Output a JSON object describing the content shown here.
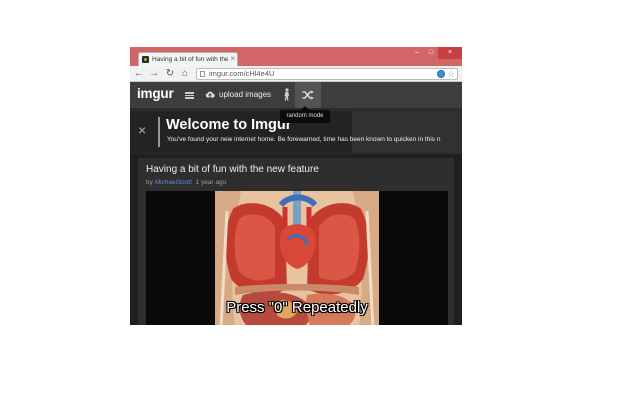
{
  "browser": {
    "tab_title": "Having a bit of fun with the",
    "tab_close": "×",
    "url": "imgur.com/cHl4e4U",
    "nav": {
      "back": "←",
      "forward": "→",
      "reload": "↻",
      "home": "⌂"
    },
    "window_controls": {
      "minimize": "–",
      "maximize": "□",
      "close": "×"
    },
    "star": "☆"
  },
  "imgur": {
    "logo": "imgur",
    "upload_label": "upload images",
    "tooltip": "random mode",
    "welcome": {
      "close": "×",
      "title": "Welcome to Imgur",
      "subtitle": "You've found your new internet home. Be forewarned, time has been known to quicken in this n"
    },
    "post": {
      "title": "Having a bit of fun with the new feature",
      "by": "by",
      "author": "MichaelScott",
      "age": "1 year ago",
      "caption": "Press \"0\" Repeatedly"
    }
  },
  "colors": {
    "window_frame": "#d26565",
    "imgur_topbar": "#3d3d3d",
    "imgur_bg": "#2b2b2b",
    "author_link": "#5f8dd3"
  },
  "icons": [
    "favicon-icon",
    "page-icon",
    "globe-icon",
    "star-icon",
    "menu-icon",
    "upload-icon",
    "meme-icon",
    "shuffle-icon",
    "close-icon"
  ]
}
